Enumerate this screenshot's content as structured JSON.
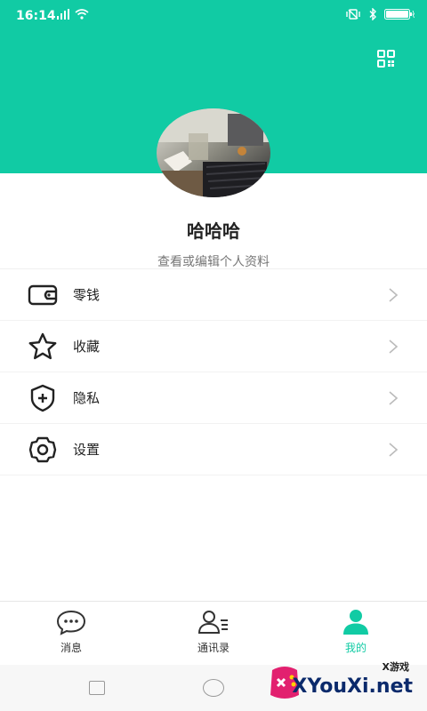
{
  "status_bar": {
    "time": "16:14",
    "signal_icon": "signal-icon",
    "wifi_icon": "wifi-icon",
    "vibrate_icon": "vibrate-icon",
    "bluetooth_icon": "bluetooth-icon",
    "battery_icon": "battery-icon"
  },
  "header": {
    "background_color": "#11CBA4",
    "qr_icon": "qr-code-icon"
  },
  "profile": {
    "username": "哈哈哈",
    "edit_link": "查看或编辑个人资料"
  },
  "menu": {
    "items": [
      {
        "label": "零钱",
        "icon": "wallet-icon"
      },
      {
        "label": "收藏",
        "icon": "star-icon"
      },
      {
        "label": "隐私",
        "icon": "shield-plus-icon"
      },
      {
        "label": "设置",
        "icon": "gear-icon"
      }
    ]
  },
  "tabbar": {
    "tabs": [
      {
        "label": "消息",
        "icon": "chat-bubble-icon",
        "active": false
      },
      {
        "label": "通讯录",
        "icon": "contacts-icon",
        "active": false
      },
      {
        "label": "我的",
        "icon": "person-icon",
        "active": true
      }
    ]
  },
  "watermark": {
    "small": "X游戏",
    "big": "XYouXi.net"
  }
}
